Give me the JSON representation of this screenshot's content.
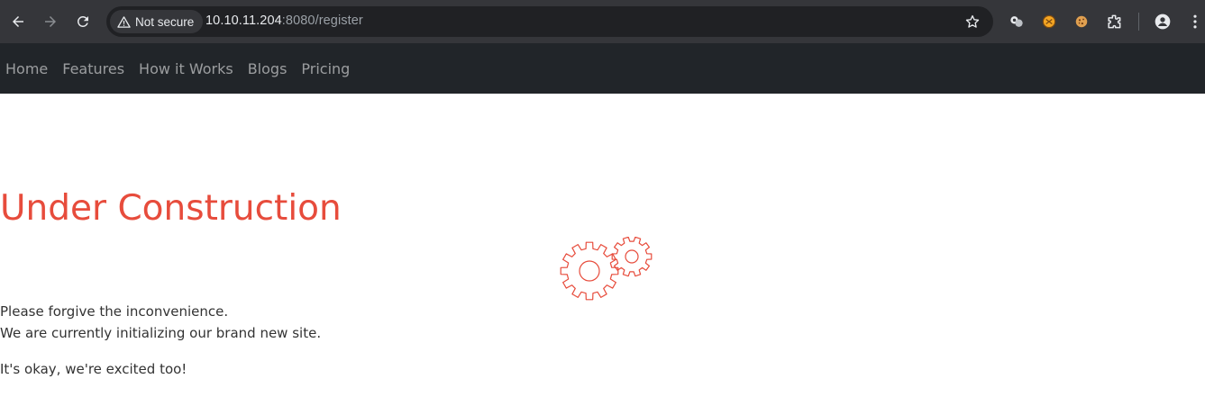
{
  "browser": {
    "security_label": "Not secure",
    "url_host": "10.10.11.204",
    "url_rest": ":8080/register"
  },
  "navbar": {
    "items": [
      {
        "label": "Home"
      },
      {
        "label": "Features"
      },
      {
        "label": "How it Works"
      },
      {
        "label": "Blogs"
      },
      {
        "label": "Pricing"
      }
    ]
  },
  "main": {
    "title": "Under Construction",
    "line1": "Please forgive the inconvenience.",
    "line2": "We are currently initializing our brand new site.",
    "line3": "It's okay, we're excited too!"
  },
  "colors": {
    "accent": "#e74c3c",
    "navbar_bg": "#212529",
    "chrome_bg": "#35363a"
  }
}
